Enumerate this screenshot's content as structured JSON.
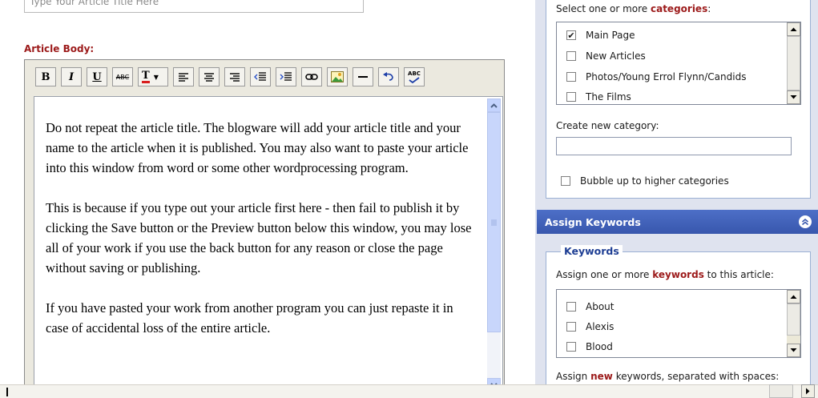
{
  "title_field": {
    "placeholder": "Type Your Article Title Here"
  },
  "article_body_label": "Article Body:",
  "toolbar": {
    "bold": "B",
    "italic": "I",
    "underline": "U",
    "strikethrough": "ABC",
    "font_color": "T",
    "spell": "ABC"
  },
  "editor": {
    "paragraphs": [
      "Do not repeat the article title. The blogware will add your article title and your name to the article when it is published. You may also want to paste your article into this window from word or some other wordprocessing program.",
      "This is because if you type out your article first here - then fail to publish it by clicking the Save button or the Preview button below this window, you may lose all of your work if you use the back button for any reason or close the page without saving or publishing.",
      "If you have pasted your work from another program you can just repaste it in case of accidental loss of the entire article."
    ]
  },
  "categories": {
    "instruction_prefix": "Select one or more",
    "instruction_keyword": "categories",
    "instruction_suffix": ":",
    "items": [
      {
        "label": "Main Page",
        "checked": true
      },
      {
        "label": "New Articles",
        "checked": false
      },
      {
        "label": "Photos/Young Errol Flynn/Candids",
        "checked": false
      },
      {
        "label": "The Films",
        "checked": false
      }
    ],
    "create_label": "Create new category:",
    "new_category_value": "",
    "bubble_label": "Bubble up to higher categories"
  },
  "keywords_section": {
    "header": "Assign Keywords",
    "legend": "Keywords",
    "instruction_prefix": "Assign one or more",
    "instruction_keyword": "keywords",
    "instruction_suffix": "to this article:",
    "items": [
      {
        "label": "About",
        "checked": false
      },
      {
        "label": "Alexis",
        "checked": false
      },
      {
        "label": "Blood",
        "checked": false
      }
    ],
    "new_prefix": "Assign",
    "new_keyword": "new",
    "new_suffix": "keywords, separated with spaces:"
  },
  "colors": {
    "accent_red": "#9c1a1a",
    "header_blue": "#3e5fb8",
    "panel_bg": "#dfe3ef"
  }
}
